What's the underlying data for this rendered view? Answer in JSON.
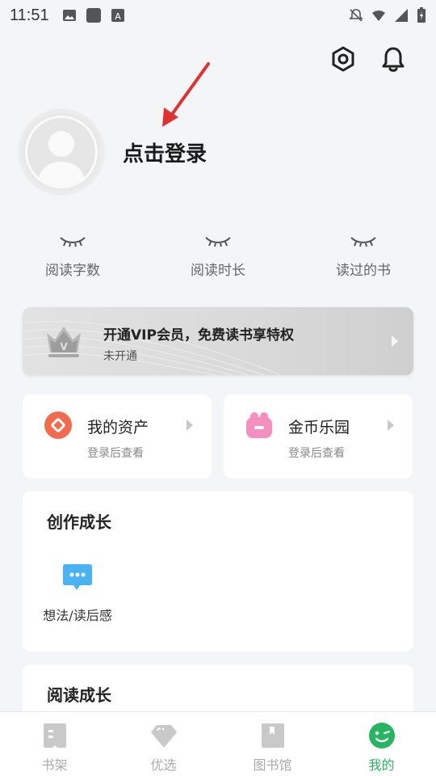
{
  "status_bar": {
    "time": "11:51"
  },
  "profile": {
    "login_text": "点击登录"
  },
  "stats": [
    {
      "label": "阅读字数"
    },
    {
      "label": "阅读时长"
    },
    {
      "label": "读过的书"
    }
  ],
  "vip": {
    "title": "开通VIP会员，免费读书享特权",
    "subtitle": "未开通"
  },
  "assets": [
    {
      "title": "我的资产",
      "subtitle": "登录后查看",
      "icon": "coin-red-icon"
    },
    {
      "title": "金币乐园",
      "subtitle": "登录后查看",
      "icon": "pink-bag-icon"
    }
  ],
  "creation": {
    "title": "创作成长",
    "items": [
      {
        "label": "想法/读后感",
        "icon": "chat-bubble-icon"
      }
    ]
  },
  "reading": {
    "title": "阅读成长"
  },
  "tabbar": {
    "tabs": [
      {
        "label": "书架"
      },
      {
        "label": "优选"
      },
      {
        "label": "图书馆"
      },
      {
        "label": "我的"
      }
    ],
    "active_index": 3
  },
  "colors": {
    "accent": "#27b561",
    "arrow": "#e03232",
    "vip_bg": "#d9d9d9",
    "page_bg": "#f4f5f7"
  }
}
